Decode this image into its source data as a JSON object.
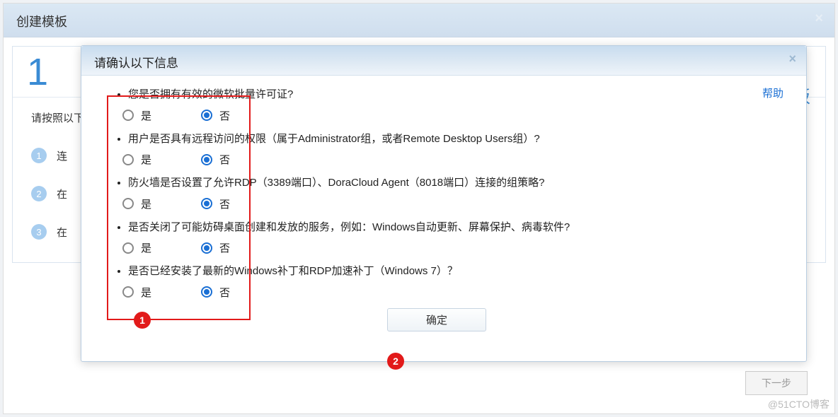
{
  "bg": {
    "title": "创建模板",
    "step_num": "1",
    "step_suffix": "式模板",
    "instr": "请按照以下",
    "bullets": [
      "连",
      "在",
      "在"
    ],
    "next": "下一步"
  },
  "modal": {
    "title": "请确认以下信息",
    "help": "帮助",
    "yes": "是",
    "no": "否",
    "questions": [
      {
        "text": "您是否拥有有效的微软批量许可证?",
        "selected": "no"
      },
      {
        "text": "用户是否具有远程访问的权限（属于Administrator组，或者Remote Desktop Users组）?",
        "selected": "no"
      },
      {
        "text": "防火墙是否设置了允许RDP（3389端口）、DoraCloud Agent（8018端口）连接的组策略?",
        "selected": "no"
      },
      {
        "text": "是否关闭了可能妨碍桌面创建和发放的服务，例如：Windows自动更新、屏幕保护、病毒软件?",
        "selected": "no"
      },
      {
        "text": "是否已经安装了最新的Windows补丁和RDP加速补丁（Windows 7）？",
        "selected": "no"
      }
    ],
    "confirm": "确定"
  },
  "watermark": "@51CTO博客",
  "annotations": {
    "marker1": "1",
    "marker2": "2"
  }
}
